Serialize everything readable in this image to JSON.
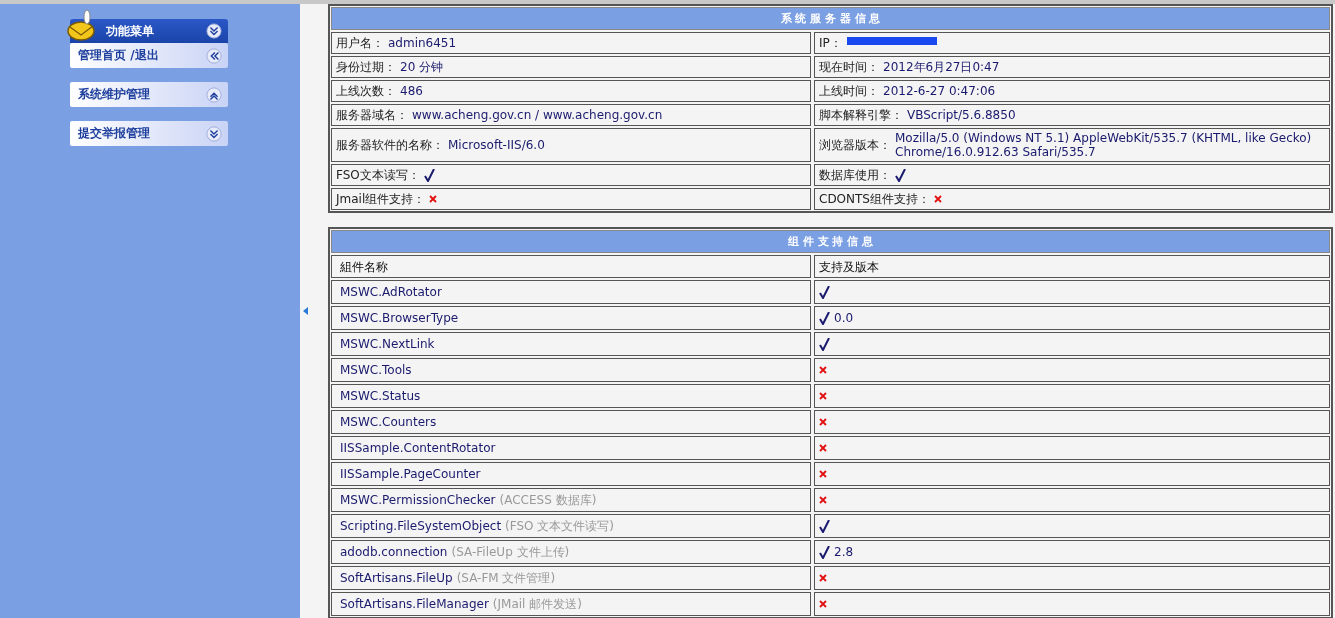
{
  "sidebar": {
    "title": "功能菜单",
    "items": [
      {
        "label": "管理首页 /退出",
        "kind": "left"
      },
      {
        "label": "系统维护管理",
        "kind": "up"
      },
      {
        "label": "提交举报管理",
        "kind": "down"
      }
    ]
  },
  "server_info": {
    "title": "系 统 服 务 器 信 息",
    "rows": [
      {
        "kind": "redacted",
        "left": {
          "label": "用户名：",
          "value": "admin6451"
        },
        "right": {
          "label": "IP："
        }
      },
      {
        "kind": "text",
        "left": {
          "label": "身份过期：",
          "value": "20 分钟"
        },
        "right": {
          "label": "现在时间：",
          "value": "2012年6月27日0:47"
        }
      },
      {
        "kind": "text",
        "left": {
          "label": "上线次数：",
          "value": "486"
        },
        "right": {
          "label": "上线时间：",
          "value": "2012-6-27 0:47:06"
        }
      },
      {
        "kind": "text",
        "left": {
          "label": "服务器域名：",
          "value": "www.acheng.gov.cn / www.acheng.gov.cn"
        },
        "right": {
          "label": "脚本解释引擎：",
          "value": "VBScript/5.6.8850"
        }
      },
      {
        "kind": "text",
        "left": {
          "label": "服务器软件的名称：",
          "value": "Microsoft-IIS/6.0"
        },
        "right": {
          "label": "浏览器版本：",
          "value": "Mozilla/5.0 (Windows NT 5.1) AppleWebKit/535.7 (KHTML, like Gecko) Chrome/16.0.912.63 Safari/535.7"
        }
      },
      {
        "kind": "support",
        "left": {
          "label": "FSO文本读写：",
          "supported": true
        },
        "right": {
          "label": "数据库使用：",
          "supported": true
        }
      },
      {
        "kind": "support",
        "left": {
          "label": "Jmail组件支持：",
          "supported": false
        },
        "right": {
          "label": "CDONTS组件支持：",
          "supported": false
        }
      }
    ]
  },
  "components": {
    "title": "组 件 支 持 信 息",
    "columns": [
      "組件名称",
      "支持及版本"
    ],
    "rows": [
      {
        "name": "MSWC.AdRotator",
        "supported": true
      },
      {
        "name": "MSWC.BrowserType",
        "supported": true,
        "version": "0.0"
      },
      {
        "name": "MSWC.NextLink",
        "supported": true
      },
      {
        "name": "MSWC.Tools",
        "supported": false
      },
      {
        "name": "MSWC.Status",
        "supported": false
      },
      {
        "name": "MSWC.Counters",
        "supported": false
      },
      {
        "name": "IISSample.ContentRotator",
        "supported": false
      },
      {
        "name": "IISSample.PageCounter",
        "supported": false
      },
      {
        "name": "MSWC.PermissionChecker",
        "note": "(ACCESS 数据库)",
        "supported": false
      },
      {
        "name": "Scripting.FileSystemObject",
        "note": "(FSO 文本文件读写)",
        "supported": true
      },
      {
        "name": "adodb.connection",
        "note": "(SA-FileUp 文件上传)",
        "supported": true,
        "version": "2.8"
      },
      {
        "name": "SoftArtisans.FileUp",
        "note": "(SA-FM 文件管理)",
        "supported": false
      },
      {
        "name": "SoftArtisans.FileManager",
        "note": "(JMail 邮件发送)",
        "supported": false
      }
    ]
  }
}
